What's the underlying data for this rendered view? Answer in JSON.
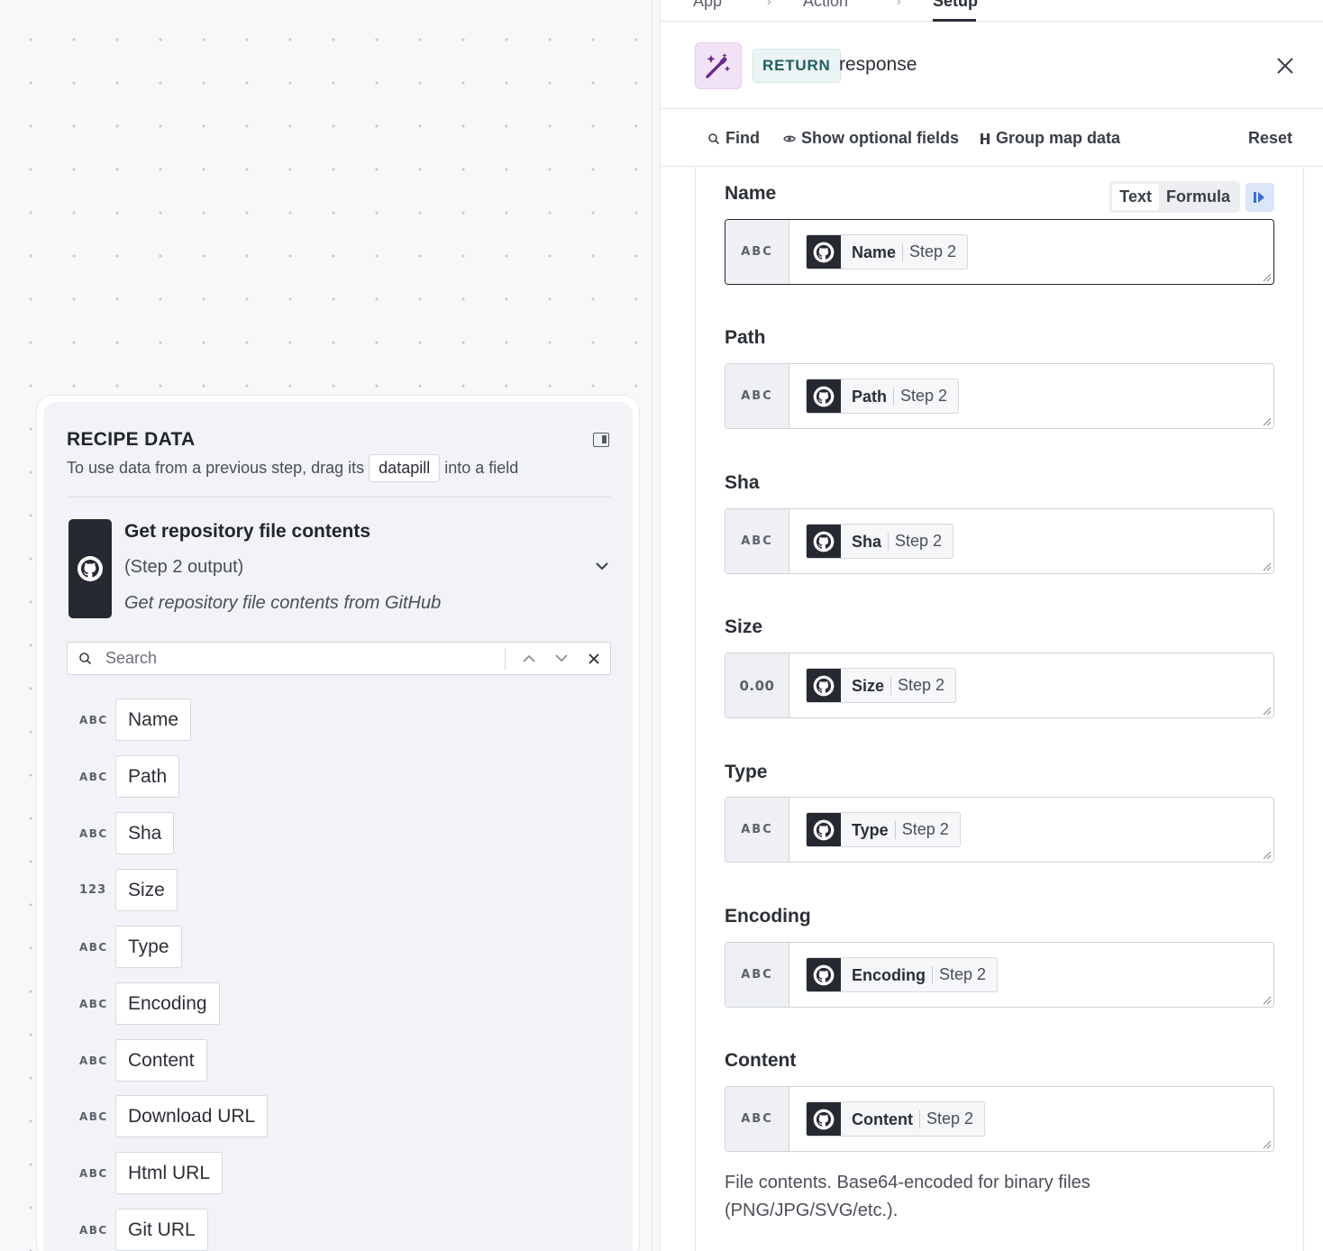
{
  "breadcrumb_tabs": [
    "App",
    "Action",
    "Setup"
  ],
  "recipe_data": {
    "title": "RECIPE DATA",
    "instruction_before": "To use data from a previous step, drag its",
    "instruction_pill": "datapill",
    "instruction_after": "into a field",
    "step": {
      "title": "Get repository file contents",
      "subtitle": "(Step 2 output)",
      "description": "Get repository file contents from GitHub",
      "icon": "github-icon"
    },
    "search": {
      "placeholder": "Search",
      "value": ""
    },
    "pills": [
      {
        "type": "ABC",
        "label": "Name"
      },
      {
        "type": "ABC",
        "label": "Path"
      },
      {
        "type": "ABC",
        "label": "Sha"
      },
      {
        "type": "123",
        "label": "Size"
      },
      {
        "type": "ABC",
        "label": "Type"
      },
      {
        "type": "ABC",
        "label": "Encoding"
      },
      {
        "type": "ABC",
        "label": "Content"
      },
      {
        "type": "ABC",
        "label": "Download URL"
      },
      {
        "type": "ABC",
        "label": "Html URL"
      },
      {
        "type": "ABC",
        "label": "Git URL"
      }
    ]
  },
  "editor": {
    "badge": "RETURN",
    "name": "response",
    "icon": "magic-wand-icon",
    "toolbar": {
      "find": "Find",
      "optional": "Show optional fields",
      "group": "Group map data",
      "reset": "Reset"
    },
    "mode": {
      "text": "Text",
      "formula": "Formula"
    },
    "fields": [
      {
        "label": "Name",
        "type": "ABC",
        "pill": "Name",
        "step": "Step 2"
      },
      {
        "label": "Path",
        "type": "ABC",
        "pill": "Path",
        "step": "Step 2"
      },
      {
        "label": "Sha",
        "type": "ABC",
        "pill": "Sha",
        "step": "Step 2"
      },
      {
        "label": "Size",
        "type": "0.00",
        "pill": "Size",
        "step": "Step 2"
      },
      {
        "label": "Type",
        "type": "ABC",
        "pill": "Type",
        "step": "Step 2"
      },
      {
        "label": "Encoding",
        "type": "ABC",
        "pill": "Encoding",
        "step": "Step 2"
      },
      {
        "label": "Content",
        "type": "ABC",
        "pill": "Content",
        "step": "Step 2"
      }
    ],
    "content_hint": "File contents. Base64-encoded for binary files (PNG/JPG/SVG/etc.)."
  },
  "colors": {
    "accent_blue": "#3b6fd8",
    "return_badge_text": "#1f5d63",
    "wand_purple": "#6a2b8c",
    "github_dark": "#262a30"
  }
}
